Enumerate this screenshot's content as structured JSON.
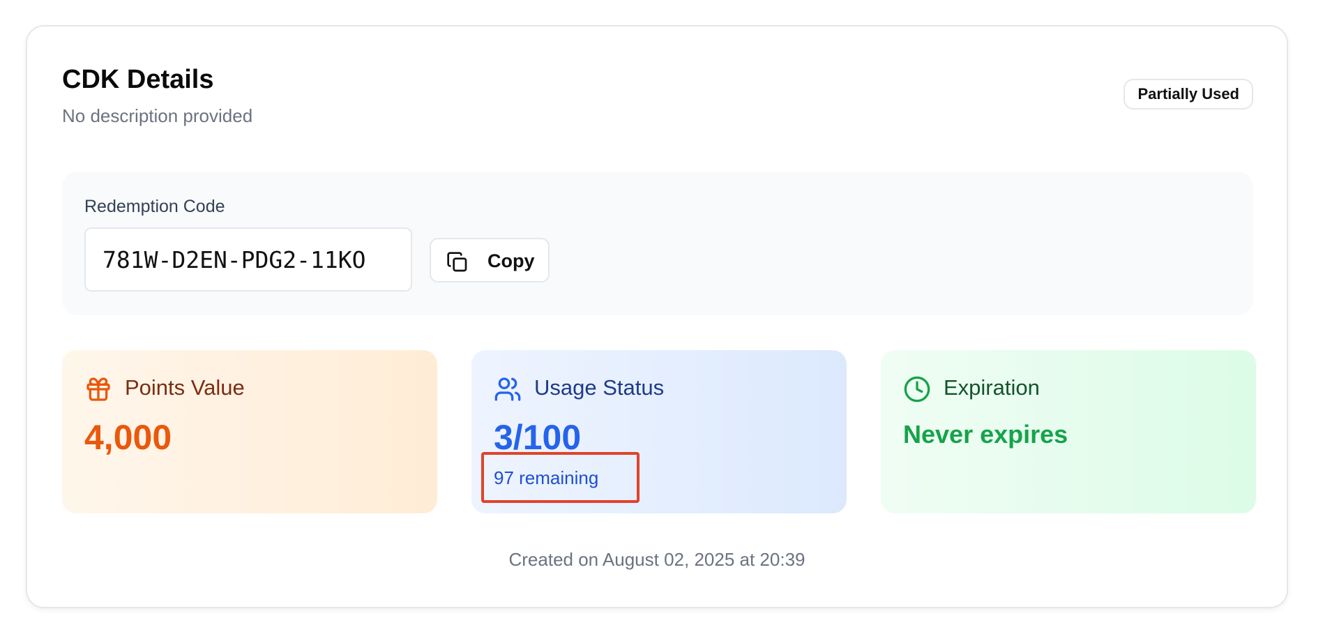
{
  "card": {
    "title": "CDK Details",
    "subtitle": "No description provided",
    "status_badge": "Partially Used"
  },
  "redemption": {
    "label": "Redemption Code",
    "code": "781W-D2EN-PDG2-11KO",
    "copy_label": "Copy",
    "copy_icon": "copy-icon"
  },
  "stats": {
    "points": {
      "icon": "gift-icon",
      "label": "Points Value",
      "value": "4,000"
    },
    "usage": {
      "icon": "users-icon",
      "label": "Usage Status",
      "value": "3/100",
      "remaining": "97 remaining"
    },
    "expiration": {
      "icon": "clock-icon",
      "label": "Expiration",
      "value": "Never expires"
    }
  },
  "footer": {
    "created": "Created on August 02, 2025 at 20:39"
  },
  "colors": {
    "points_accent": "#ea580c",
    "usage_accent": "#2563eb",
    "expiration_accent": "#16a34a",
    "highlight_box": "#e0432a"
  }
}
